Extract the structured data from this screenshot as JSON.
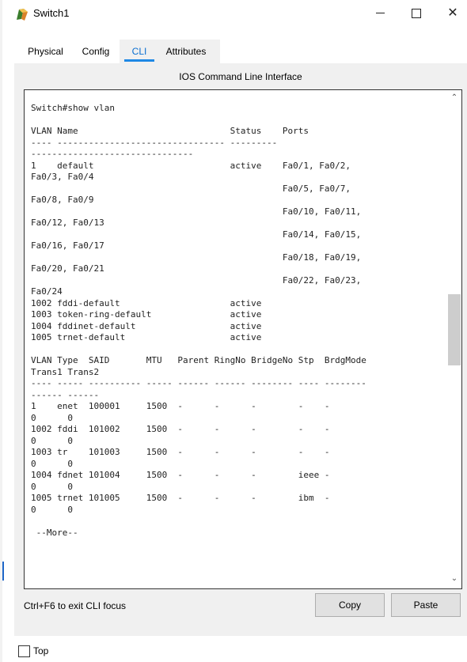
{
  "window": {
    "title": "Switch1",
    "icon": "switch-device-icon",
    "controls": [
      "minimize",
      "maximize",
      "close"
    ],
    "close_glyph": "✕"
  },
  "tabs": [
    {
      "label": "Physical"
    },
    {
      "label": "Config"
    },
    {
      "label": "CLI",
      "active": true
    },
    {
      "label": "Attributes"
    }
  ],
  "cli": {
    "heading": "IOS Command Line Interface",
    "lines": [
      "Switch#show vlan",
      "",
      "VLAN Name                             Status    Ports",
      "---- -------------------------------- ---------",
      "-------------------------------",
      "1    default                          active    Fa0/1, Fa0/2,",
      "Fa0/3, Fa0/4",
      "                                                Fa0/5, Fa0/7,",
      "Fa0/8, Fa0/9",
      "                                                Fa0/10, Fa0/11,",
      "Fa0/12, Fa0/13",
      "                                                Fa0/14, Fa0/15,",
      "Fa0/16, Fa0/17",
      "                                                Fa0/18, Fa0/19,",
      "Fa0/20, Fa0/21",
      "                                                Fa0/22, Fa0/23,",
      "Fa0/24",
      "1002 fddi-default                     active",
      "1003 token-ring-default               active",
      "1004 fddinet-default                  active",
      "1005 trnet-default                    active",
      "",
      "VLAN Type  SAID       MTU   Parent RingNo BridgeNo Stp  BrdgMode",
      "Trans1 Trans2",
      "---- ----- ---------- ----- ------ ------ -------- ---- --------",
      "------ ------",
      "1    enet  100001     1500  -      -      -        -    -",
      "0      0",
      "1002 fddi  101002     1500  -      -      -        -    -",
      "0      0",
      "1003 tr    101003     1500  -      -      -        -    -",
      "0      0",
      "1004 fdnet 101004     1500  -      -      -        ieee -",
      "0      0",
      "1005 trnet 101005     1500  -      -      -        ibm  -",
      "0      0",
      "",
      " --More--"
    ],
    "exit_hint": "Ctrl+F6 to exit CLI focus",
    "copy_label": "Copy",
    "paste_label": "Paste"
  },
  "footer": {
    "top_label": "Top",
    "top_checked": false
  },
  "colors": {
    "active_tab_text": "#0a6fd1",
    "active_tab_underline": "#1e88e5",
    "panel_bg": "#f0f0f0"
  }
}
